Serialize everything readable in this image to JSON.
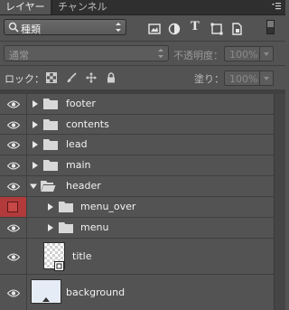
{
  "panel": {
    "tabs": [
      {
        "label": "レイヤー",
        "active": true
      },
      {
        "label": "チャンネル",
        "active": false
      }
    ],
    "filter": {
      "kind_label": "種類",
      "icons": [
        "pixel-filter-icon",
        "adjustment-filter-icon",
        "text-filter-icon",
        "shape-filter-icon",
        "smart-object-filter-icon"
      ],
      "text_icon_glyph": "T"
    },
    "blend": {
      "mode": "通常",
      "opacity_label": "不透明度：",
      "opacity_value": "100%"
    },
    "lock": {
      "label": "ロック：",
      "fill_label": "塗り：",
      "fill_value": "100%"
    },
    "layers": [
      {
        "name": "footer",
        "type": "group",
        "expanded": false,
        "depth": 0,
        "visible": true
      },
      {
        "name": "contents",
        "type": "group",
        "expanded": false,
        "depth": 0,
        "visible": true
      },
      {
        "name": "lead",
        "type": "group",
        "expanded": false,
        "depth": 0,
        "visible": true
      },
      {
        "name": "main",
        "type": "group",
        "expanded": false,
        "depth": 0,
        "visible": true
      },
      {
        "name": "header",
        "type": "group",
        "expanded": true,
        "depth": 0,
        "visible": true
      },
      {
        "name": "menu_over",
        "type": "group",
        "expanded": false,
        "depth": 1,
        "visible": false,
        "label_color": "red"
      },
      {
        "name": "menu",
        "type": "group",
        "expanded": false,
        "depth": 1,
        "visible": true
      },
      {
        "name": "title",
        "type": "smart-object",
        "depth": 0,
        "visible": true
      },
      {
        "name": "background",
        "type": "image",
        "depth": 0,
        "visible": true
      }
    ]
  },
  "colors": {
    "panel_bg": "#535353",
    "hidden_label": "#b23a3a",
    "background_thumb": "#e6ecf6"
  }
}
